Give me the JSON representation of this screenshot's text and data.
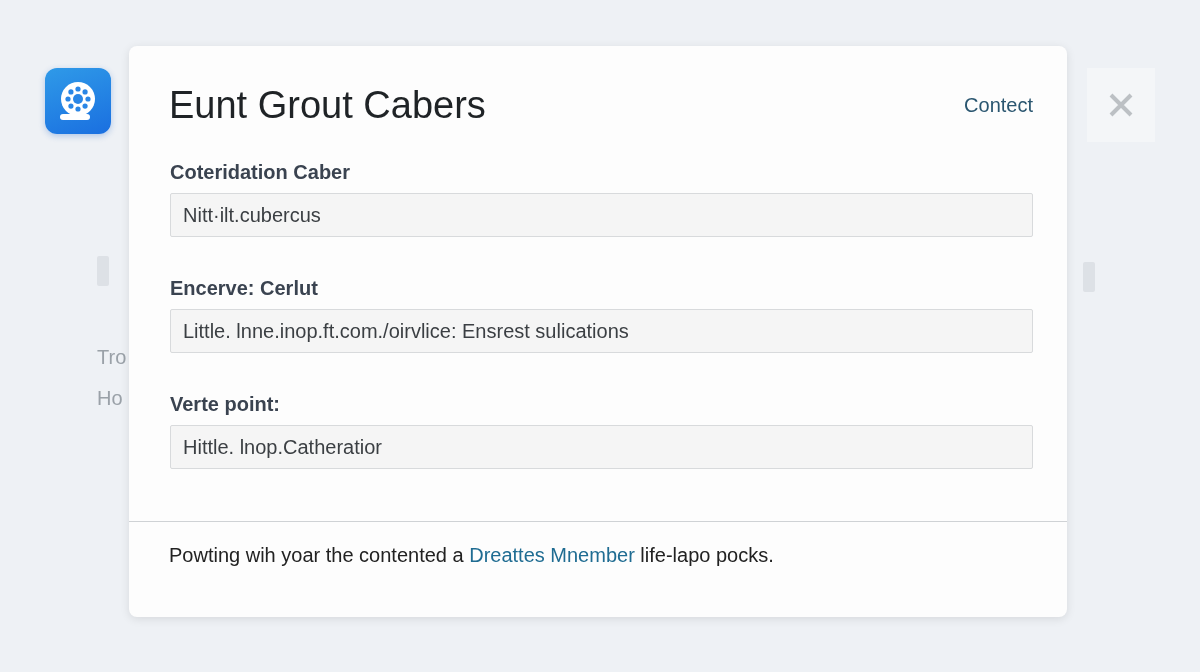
{
  "background": {
    "texts": [
      "Tro",
      "Ho"
    ]
  },
  "dialog": {
    "title": "Eunt Grout Cabers",
    "header_link": "Contect",
    "fields": [
      {
        "label": "Coteridation Caber",
        "value": "Nitt·ilt.cubercus"
      },
      {
        "label": "Encerve: Cerlut",
        "value": "Little. lnne.inop.ft.com./oirvlice: Ensrest sulications"
      },
      {
        "label": "Verte point:",
        "value": "Hittle. lnop.Catheratior"
      }
    ],
    "footer": {
      "text_before": "Powting wih yoar the contented a ",
      "link": "Dreattes Mnember",
      "text_after": " life-lapo pocks."
    }
  }
}
